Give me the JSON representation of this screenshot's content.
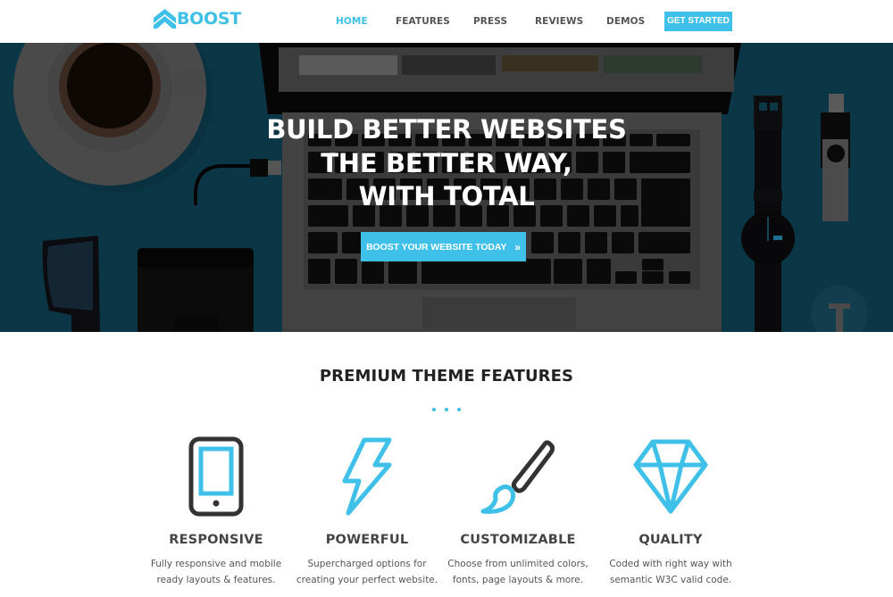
{
  "header": {
    "logo_text": "BOOST",
    "nav": [
      {
        "label": "HOME",
        "active": true
      },
      {
        "label": "FEATURES",
        "active": false
      },
      {
        "label": "PRESS",
        "active": false
      },
      {
        "label": "REVIEWS",
        "active": false
      },
      {
        "label": "DEMOS",
        "active": false
      }
    ],
    "cta_label": "GET STARTED"
  },
  "hero": {
    "title_lines": [
      "BUILD BETTER WEBSITES",
      "THE BETTER WAY,",
      "WITH TOTAL"
    ],
    "button_label": "BOOST YOUR WEBSITE TODAY",
    "button_icon": "double-chevron-right-icon",
    "button_glyph": "»"
  },
  "features": {
    "title": "PREMIUM THEME FEATURES",
    "items": [
      {
        "icon": "tablet-icon",
        "title": "RESPONSIVE",
        "desc_lines": [
          "Fully responsive and mobile",
          "ready layouts & features."
        ]
      },
      {
        "icon": "lightning-bolt-icon",
        "title": "POWERFUL",
        "desc_lines": [
          "Supercharged options for",
          "creating your perfect website."
        ]
      },
      {
        "icon": "paint-brush-icon",
        "title": "CUSTOMIZABLE",
        "desc_lines": [
          "Choose from unlimited colors,",
          "fonts, page layouts & more."
        ]
      },
      {
        "icon": "diamond-icon",
        "title": "QUALITY",
        "desc_lines": [
          "Coded with right way with",
          "semantic W3C valid code."
        ]
      }
    ]
  },
  "colors": {
    "accent": "#3ec0e8",
    "icon_dark": "#333333",
    "hero_bg": "#0b3646"
  }
}
